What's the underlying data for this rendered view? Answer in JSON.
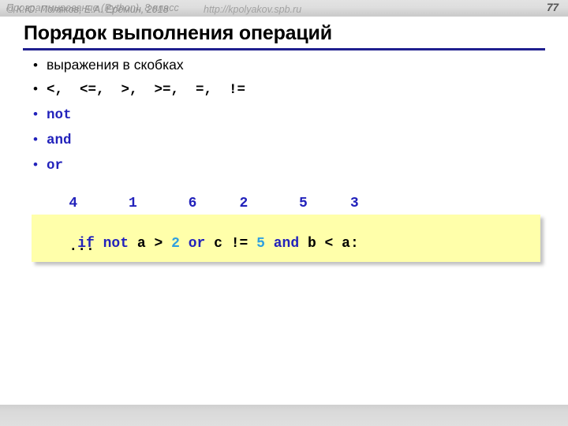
{
  "header": {
    "course_title": "Программирование (Python), 8 класс",
    "page_number": "77",
    "bullet_glyph": "•"
  },
  "slide": {
    "title": "Порядок выполнения операций",
    "rule_color": "#1f1f8f"
  },
  "bullets": [
    {
      "text": "выражения в скобках",
      "style": "plain",
      "dot_color": "black"
    },
    {
      "text": "<,  <=,  >,  >=,  =,  !=",
      "style": "mono",
      "dot_color": "black"
    },
    {
      "text": "not",
      "style": "keyword",
      "dot_color": "blue"
    },
    {
      "text": "and",
      "style": "keyword",
      "dot_color": "blue"
    },
    {
      "text": "or",
      "style": "keyword",
      "dot_color": "blue"
    }
  ],
  "priority": {
    "numbers_line": "   4      1      6     2      5     3",
    "numbers": [
      "4",
      "1",
      "6",
      "2",
      "5",
      "3"
    ],
    "color": "#2222bb"
  },
  "code": {
    "background": "#ffffaa",
    "keyword_color": "#2222bb",
    "number_color": "#2e9fe0",
    "line1_tokens": [
      {
        "t": "if ",
        "k": "kw"
      },
      {
        "t": "not ",
        "k": "kw"
      },
      {
        "t": "a > ",
        "k": "norm"
      },
      {
        "t": "2",
        "k": "num"
      },
      {
        "t": " ",
        "k": "norm"
      },
      {
        "t": "or ",
        "k": "kw"
      },
      {
        "t": "c != ",
        "k": "norm"
      },
      {
        "t": "5",
        "k": "num"
      },
      {
        "t": " ",
        "k": "norm"
      },
      {
        "t": "and ",
        "k": "kw"
      },
      {
        "t": "b < a:",
        "k": "norm"
      }
    ],
    "line1_plain": "if not a > 2 or c != 5 and b < a:",
    "line2": "   ..."
  },
  "footer": {
    "copyright": "© К.Ю. Поляков, Е.А. Ерёмин, 2018",
    "url": "http://kpolyakov.spb.ru"
  }
}
